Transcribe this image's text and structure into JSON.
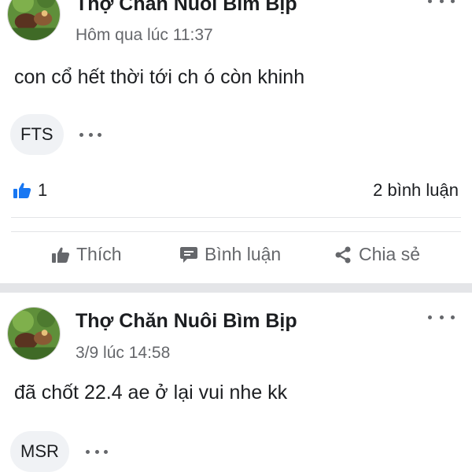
{
  "posts": [
    {
      "author": "Thợ Chăn Nuôi Bìm Bịp",
      "time": "Hôm qua lúc 11:37",
      "content": "con cổ hết thời tới ch ó còn khinh",
      "tag": "FTS",
      "likes": "1",
      "comments": "2 bình luận"
    },
    {
      "author": "Thợ Chăn Nuôi Bìm Bịp",
      "time": "3/9 lúc 14:58",
      "content": "đã chốt 22.4 ae ở lại vui nhe kk",
      "tag": "MSR"
    }
  ],
  "actions": {
    "like": "Thích",
    "comment": "Bình luận",
    "share": "Chia sẻ"
  },
  "icons": {
    "more": "more-horizontal-icon",
    "like_reaction": "thumbs-up-reaction-icon",
    "like": "thumbs-up-icon",
    "comment": "comment-bubble-icon",
    "share": "share-icon"
  },
  "colors": {
    "like_blue": "#1877f2",
    "secondary_text": "#65676b",
    "tag_background": "#f0f2f5",
    "separator": "#e4e5e8"
  }
}
